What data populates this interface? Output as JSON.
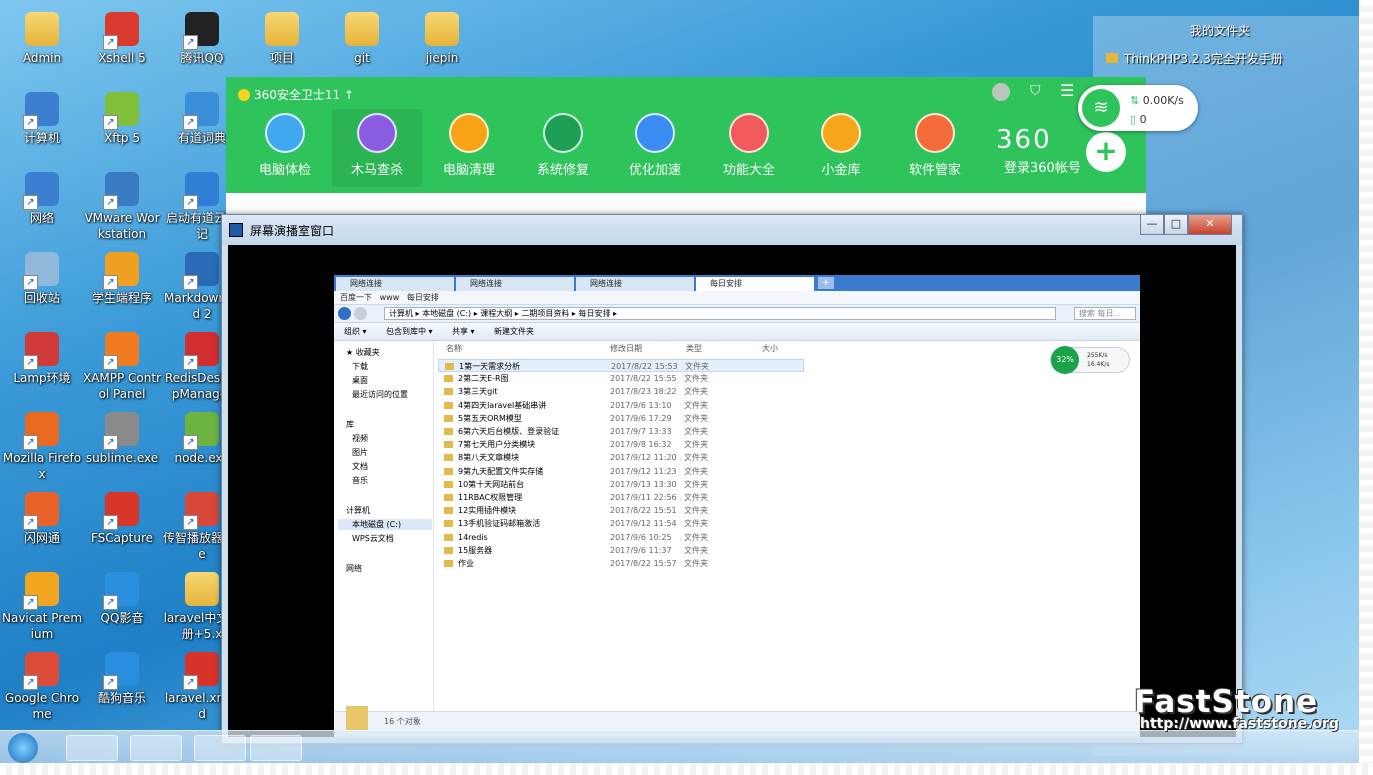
{
  "desktop": {
    "icons": [
      {
        "label": "Admin",
        "icon": "folder-icon",
        "color": "#e8b63c"
      },
      {
        "label": "Xshell 5",
        "icon": "xshell-icon",
        "color": "#d93a2d"
      },
      {
        "label": "腾讯QQ",
        "icon": "qq-icon",
        "color": "#222222"
      },
      {
        "label": "项目",
        "icon": "folder-icon",
        "color": "#e8b63c"
      },
      {
        "label": "git",
        "icon": "folder-icon",
        "color": "#e8b63c"
      },
      {
        "label": "jiepin",
        "icon": "folder-icon",
        "color": "#e8b63c"
      },
      {
        "label": "计算机",
        "icon": "computer-icon",
        "color": "#3c7fd0"
      },
      {
        "label": "Xftp 5",
        "icon": "xftp-icon",
        "color": "#7fbf3a"
      },
      {
        "label": "有道词典",
        "icon": "youdao-icon",
        "color": "#3a8fd8"
      },
      {
        "label": "网络",
        "icon": "network-icon",
        "color": "#3c7fd0"
      },
      {
        "label": "VMware Workstation",
        "icon": "vmware-icon",
        "color": "#3a7cc4"
      },
      {
        "label": "启动有道云笔记",
        "icon": "youdao-note-icon",
        "color": "#2f7fd6"
      },
      {
        "label": "回收站",
        "icon": "recycle-bin-icon",
        "color": "#8fb8da"
      },
      {
        "label": "学生端程序",
        "icon": "student-app-icon",
        "color": "#f0a020"
      },
      {
        "label": "MarkdownPad 2",
        "icon": "markdownpad-icon",
        "color": "#2a6bb8"
      },
      {
        "label": "Lamp环境",
        "icon": "lamp-icon",
        "color": "#d03a3a"
      },
      {
        "label": "XAMPP Control Panel",
        "icon": "xampp-icon",
        "color": "#f07b20"
      },
      {
        "label": "RedisDesktopManager",
        "icon": "redis-icon",
        "color": "#d22e2e"
      },
      {
        "label": "Mozilla Firefox",
        "icon": "firefox-icon",
        "color": "#e96a1f"
      },
      {
        "label": "sublime.exe",
        "icon": "sublime-icon",
        "color": "#8a8a8a"
      },
      {
        "label": "node.exe",
        "icon": "node-icon",
        "color": "#6db33f"
      },
      {
        "label": "闪网通",
        "icon": "shanwangtong-icon",
        "color": "#e8622a"
      },
      {
        "label": "FSCapture",
        "icon": "fscapture-icon",
        "color": "#d9362a"
      },
      {
        "label": "传智播放器.exe",
        "icon": "player-icon",
        "color": "#d8473a"
      },
      {
        "label": "Navicat Premium",
        "icon": "navicat-icon",
        "color": "#f2a51f"
      },
      {
        "label": "QQ影音",
        "icon": "qqplayer-icon",
        "color": "#2b8fe0"
      },
      {
        "label": "laravel中文手册+5.x",
        "icon": "folder-icon",
        "color": "#e8b63c"
      },
      {
        "label": "Google Chrome",
        "icon": "chrome-icon",
        "color": "#dd4b39"
      },
      {
        "label": "酷狗音乐",
        "icon": "kugou-icon",
        "color": "#2b8ddf"
      },
      {
        "label": "laravel.xmind",
        "icon": "xmind-icon",
        "color": "#d8322b"
      }
    ]
  },
  "favorites": {
    "title": "我的文件夹",
    "item": "ThinkPHP3.2.3完全开发手册"
  },
  "security360": {
    "title": "360安全卫士11",
    "tools": [
      {
        "label": "电脑体检",
        "icon": "pc-check-icon",
        "color": "#3fa8ef"
      },
      {
        "label": "木马查杀",
        "icon": "trojan-kill-icon",
        "color": "#8a5de0"
      },
      {
        "label": "电脑清理",
        "icon": "cleanup-icon",
        "color": "#f7a316"
      },
      {
        "label": "系统修复",
        "icon": "system-repair-icon",
        "color": "#1da055"
      },
      {
        "label": "优化加速",
        "icon": "speedup-icon",
        "color": "#3b8cf2"
      },
      {
        "label": "功能大全",
        "icon": "all-features-icon",
        "color": "#f05a5a"
      },
      {
        "label": "小金库",
        "icon": "treasury-icon",
        "color": "#f5a61a"
      },
      {
        "label": "软件管家",
        "icon": "software-manager-icon",
        "color": "#f46b3a"
      }
    ],
    "logo": "360",
    "login": "登录360帐号",
    "accent": "#2ec45b"
  },
  "net_widget": {
    "up_speed": "0.00K/s",
    "down_value": "0"
  },
  "recorder": {
    "title": "屏幕演播室窗口",
    "minimize": "—",
    "maximize": "□",
    "close": "✕"
  },
  "explorer": {
    "tabs": [
      "网络连接",
      "网络连接",
      "网络连接",
      "每日安排"
    ],
    "bookmarks": [
      "百度一下",
      "www",
      "每日安排"
    ],
    "path": "计算机 ▸ 本地磁盘 (C:) ▸ 课程大纲 ▸ 二期项目资料 ▸ 每日安排 ▸",
    "search_placeholder": "搜索 每日...",
    "commands": [
      "组织 ▾",
      "包含到库中 ▾",
      "共享 ▾",
      "新建文件夹"
    ],
    "nav": {
      "favorites": "收藏夹",
      "downloads": "下载",
      "desktop": "桌面",
      "recent": "最近访问的位置",
      "libraries": "库",
      "videos": "视频",
      "pictures": "图片",
      "documents": "文档",
      "music": "音乐",
      "computer": "计算机",
      "local_disk": "本地磁盘 (C:)",
      "wps": "WPS云文档",
      "network": "网络"
    },
    "columns": {
      "name": "名称",
      "date": "修改日期",
      "type": "类型",
      "size": "大小"
    },
    "files": [
      {
        "name": "1第一天需求分析",
        "date": "2017/8/22 15:53",
        "type": "文件夹"
      },
      {
        "name": "2第二天E-R图",
        "date": "2017/8/22 15:55",
        "type": "文件夹"
      },
      {
        "name": "3第三天git",
        "date": "2017/8/23 18:22",
        "type": "文件夹"
      },
      {
        "name": "4第四天laravel基础串讲",
        "date": "2017/9/6 13:10",
        "type": "文件夹"
      },
      {
        "name": "5第五天ORM模型",
        "date": "2017/9/6 17:29",
        "type": "文件夹"
      },
      {
        "name": "6第六天后台模版、登录验证",
        "date": "2017/9/7 13:33",
        "type": "文件夹"
      },
      {
        "name": "7第七天用户分类模块",
        "date": "2017/9/8 16:32",
        "type": "文件夹"
      },
      {
        "name": "8第八天文章模块",
        "date": "2017/9/12 11:20",
        "type": "文件夹"
      },
      {
        "name": "9第九天配置文件实存储",
        "date": "2017/9/12 11:23",
        "type": "文件夹"
      },
      {
        "name": "10第十天网站前台",
        "date": "2017/9/13 13:30",
        "type": "文件夹"
      },
      {
        "name": "11RBAC权限管理",
        "date": "2017/9/11 22:56",
        "type": "文件夹"
      },
      {
        "name": "12实用插件模块",
        "date": "2017/8/22 15:51",
        "type": "文件夹"
      },
      {
        "name": "13手机验证码邮箱激活",
        "date": "2017/9/12 11:54",
        "type": "文件夹"
      },
      {
        "name": "14redis",
        "date": "2017/9/6 10:25",
        "type": "文件夹"
      },
      {
        "name": "15服务器",
        "date": "2017/9/6 11:37",
        "type": "文件夹"
      },
      {
        "name": "作业",
        "date": "2017/8/22 15:57",
        "type": "文件夹"
      }
    ],
    "status": "16 个对象",
    "speed_pct": "32%",
    "speed_up": "255K/s",
    "speed_down": "16.4K/s"
  },
  "watermark": {
    "brand": "FastStone",
    "url": "http://www.faststone.org"
  }
}
